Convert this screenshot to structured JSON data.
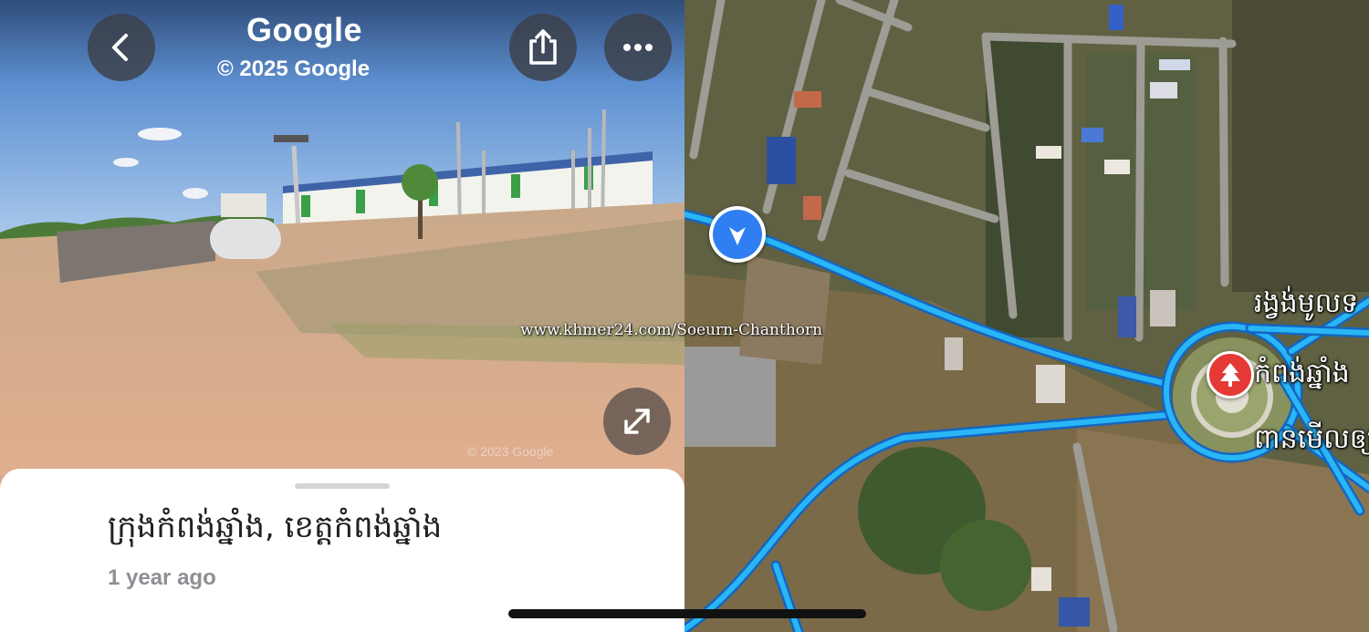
{
  "street_view": {
    "brand": "Google",
    "copyright": "© 2025 Google",
    "scene_copyright": "© 2023 Google",
    "buttons": {
      "back": "back-icon",
      "share": "share-icon",
      "more": "more-icon",
      "expand": "expand-icon"
    }
  },
  "place_sheet": {
    "title": "ក្រុងកំពង់ឆ្នាំង, ខេត្តកំពង់ឆ្នាំង",
    "age": "1 year ago"
  },
  "map": {
    "labels": [
      "រង្វង់មូលទ",
      "កំពង់ឆ្នាំង",
      "ពានមើលឲ្យ"
    ],
    "location_marker_icon": "navigation-arrow-icon",
    "poi_icon": "tree-icon",
    "route_color": "#29b6f6",
    "marker_color": "#2f7ef2",
    "poi_color": "#e53935"
  },
  "watermark": "www.khmer24.com/Soeurn-Chanthorn"
}
